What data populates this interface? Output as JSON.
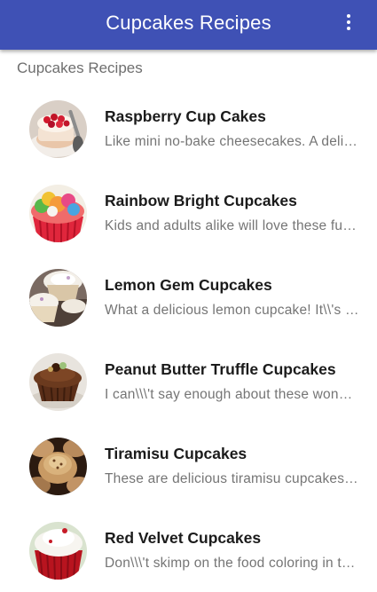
{
  "appbar": {
    "title": "Cupcakes Recipes",
    "menu_icon": "more-vert-icon",
    "color": "#3f51b5"
  },
  "section": {
    "header": "Cupcakes Recipes"
  },
  "recipes": [
    {
      "title": "Raspberry Cup Cakes",
      "description": "Like mini no-bake cheesecakes. A delicious treat",
      "image": "raspberry-cupcake-image"
    },
    {
      "title": "Rainbow Bright Cupcakes",
      "description": "Kids and adults alike will love these fun cupcakes",
      "image": "rainbow-cupcake-image"
    },
    {
      "title": "Lemon Gem Cupcakes",
      "description": "What a delicious lemon cupcake! It\\\\'s perfect",
      "image": "lemon-cupcake-image"
    },
    {
      "title": "Peanut Butter Truffle Cupcakes",
      "description": "I can\\\\\\'t say enough about these wonderful cupcakes",
      "image": "peanut-butter-cupcake-image"
    },
    {
      "title": "Tiramisu Cupcakes",
      "description": "These are delicious tiramisu cupcakes for any party",
      "image": "tiramisu-cupcake-image"
    },
    {
      "title": "Red Velvet Cupcakes",
      "description": "Don\\\\\\'t skimp on the food coloring in this recipe",
      "image": "red-velvet-cupcake-image"
    }
  ]
}
